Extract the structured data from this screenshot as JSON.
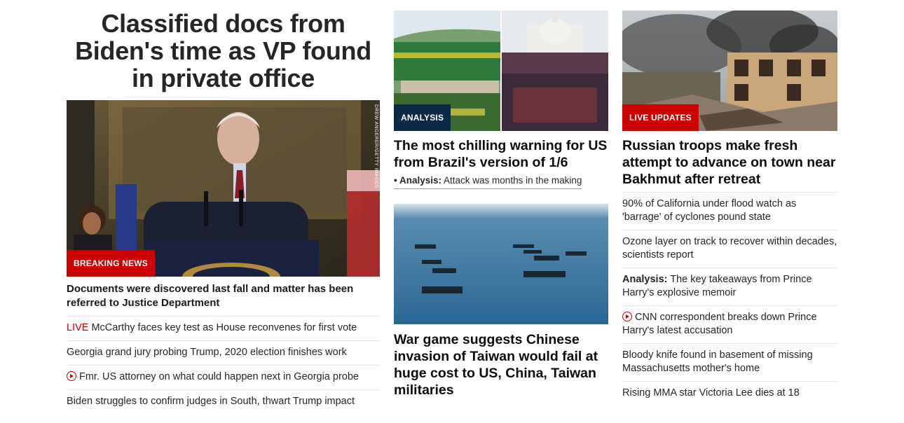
{
  "col1": {
    "headline": "Classified docs from Biden's time as VP found in private office",
    "image_badge": "BREAKING NEWS",
    "image_credit": "DREW ANGERER/GETTY IMAGES",
    "subheadline": "Documents were discovered last fall and matter has been referred to Justice Department",
    "items": [
      {
        "prefix": "LIVE",
        "text": "McCarthy faces key test as House reconvenes for first vote"
      },
      {
        "text": "Georgia grand jury probing Trump, 2020 election finishes work"
      },
      {
        "icon": "play-icon",
        "text": "Fmr. US attorney on what could happen next in Georgia probe"
      },
      {
        "text": "Biden struggles to confirm judges in South, thwart Trump impact"
      }
    ]
  },
  "col2": {
    "story1": {
      "badge": "ANALYSIS",
      "headline": "The most chilling warning for US from Brazil's version of 1/6",
      "analysis_prefix": "• Analysis:",
      "analysis_text": "Attack was months in the making"
    },
    "story2": {
      "headline": "War game suggests Chinese invasion of Taiwan would fail at huge cost to US, China, Taiwan militaries"
    }
  },
  "col3": {
    "badge": "LIVE UPDATES",
    "headline": "Russian troops make fresh attempt to advance on town near Bakhmut after retreat",
    "items": [
      {
        "text": "90% of California under flood watch as 'barrage' of cyclones pound state"
      },
      {
        "text": "Ozone layer on track to recover within decades, scientists report"
      },
      {
        "prefix": "Analysis:",
        "text": "The key takeaways from Prince Harry's explosive memoir"
      },
      {
        "icon": "play-icon",
        "text": "CNN correspondent breaks down Prince Harry's latest accusation"
      },
      {
        "text": "Bloody knife found in basement of missing Massachusetts mother's home"
      },
      {
        "text": "Rising MMA star Victoria Lee dies at 18"
      }
    ]
  },
  "colors": {
    "breaking_red": "#cc0000",
    "analysis_navy": "#0c2a45"
  }
}
